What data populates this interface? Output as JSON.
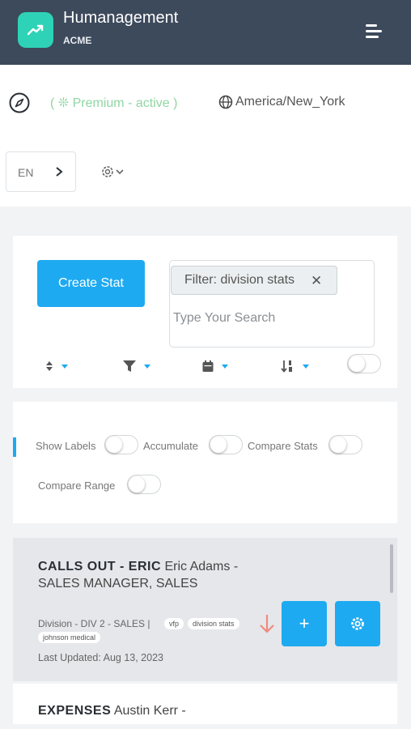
{
  "header": {
    "app_name": "Humanagement",
    "org": "ACME"
  },
  "status": {
    "premium": "( ❊ Premium - active )",
    "timezone": "America/New_York"
  },
  "lang": {
    "code": "EN"
  },
  "toolbar": {
    "create_label": "Create Stat",
    "filter_chip": "Filter: division stats",
    "filter_remove": "✕",
    "search_placeholder": "Type Your Search"
  },
  "options": {
    "show_labels": "Show Labels",
    "accumulate": "Accumulate",
    "compare_stats": "Compare Stats",
    "compare_range": "Compare Range"
  },
  "stats": [
    {
      "name": "CALLS OUT - ERIC",
      "owner": "Eric Adams - SALES MANAGER, SALES",
      "meta": "Division - DIV 2 - SALES |",
      "tags": [
        "vfp",
        "division stats",
        "johnson medical"
      ],
      "updated": "Last Updated: Aug 13, 2023",
      "trend": "down",
      "add": "+"
    },
    {
      "name": "EXPENSES",
      "owner": "Austin Kerr -"
    }
  ],
  "colors": {
    "topbar": "#3d4a5c",
    "accent": "#1eaaf1",
    "logo": "#2ed3b7",
    "premium": "#8fd6a3",
    "trend_down": "#f08a7e"
  }
}
